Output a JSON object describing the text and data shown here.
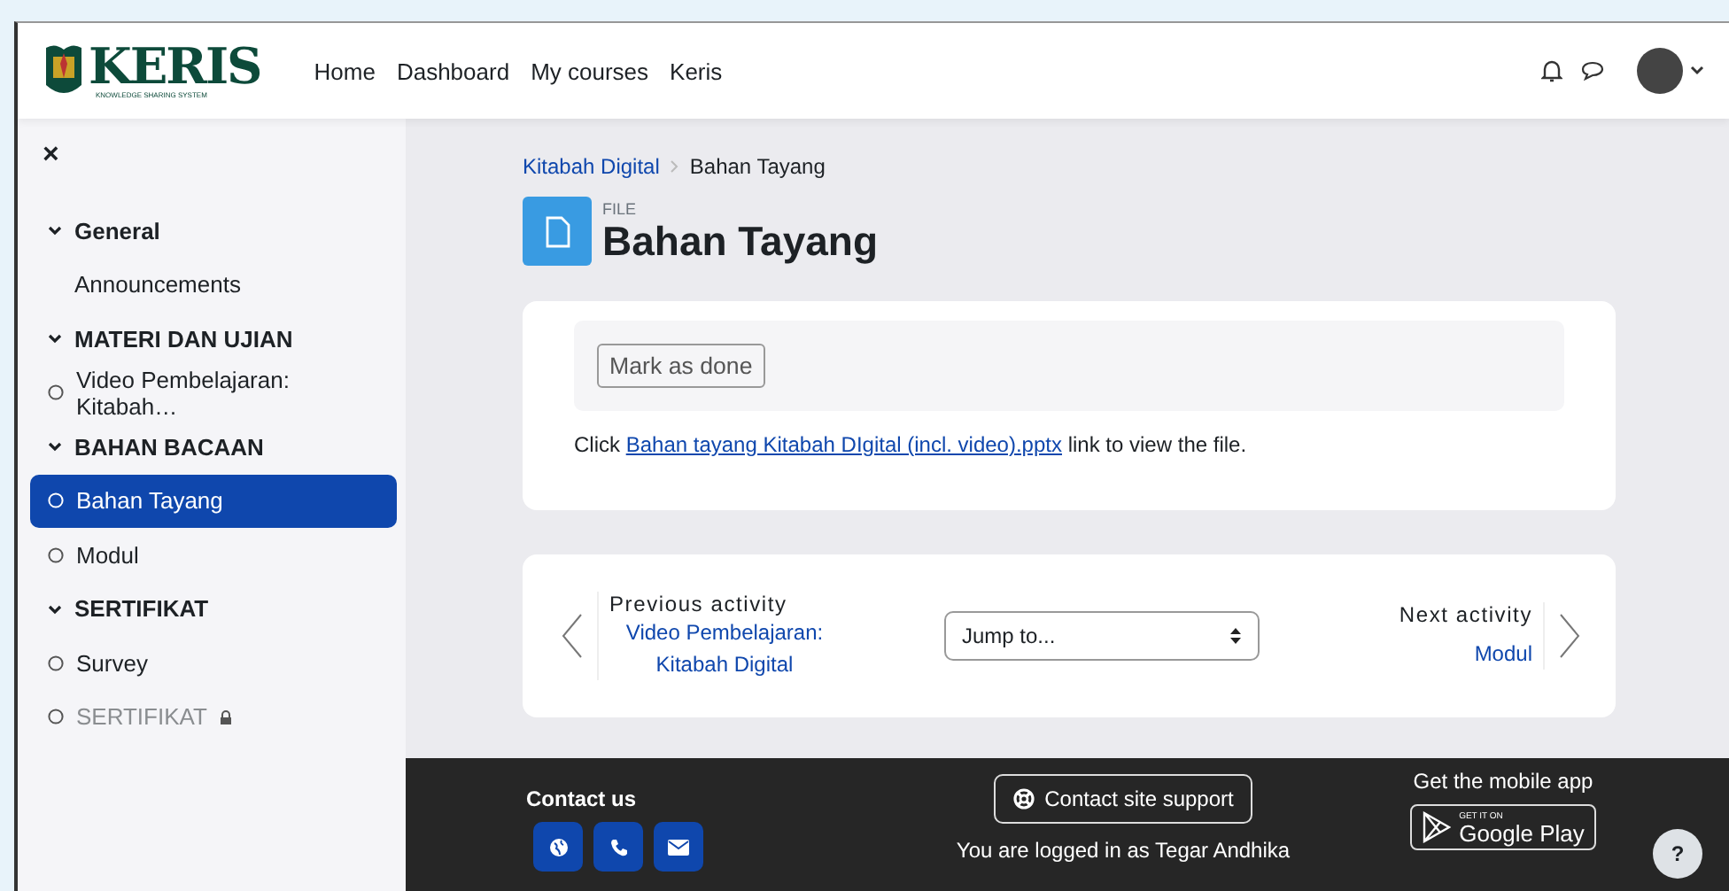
{
  "navbar": {
    "brand": "KERIS",
    "tagline": "KNOWLEDGE SHARING SYSTEM",
    "links": [
      "Home",
      "Dashboard",
      "My courses",
      "Keris"
    ]
  },
  "sidebar": {
    "close": "×",
    "items": [
      {
        "kind": "section",
        "label": "General",
        "expanded": true
      },
      {
        "kind": "plain",
        "label": "Announcements"
      },
      {
        "kind": "section",
        "label": "MATERI DAN UJIAN",
        "expanded": true
      },
      {
        "kind": "activity",
        "label": "Video Pembelajaran: Kitabah…",
        "selected": false,
        "locked": false
      },
      {
        "kind": "section",
        "label": "BAHAN BACAAN",
        "expanded": true
      },
      {
        "kind": "activity",
        "label": "Bahan Tayang",
        "selected": true,
        "locked": false
      },
      {
        "kind": "activity",
        "label": "Modul",
        "selected": false,
        "locked": false
      },
      {
        "kind": "section",
        "label": "SERTIFIKAT",
        "expanded": true
      },
      {
        "kind": "activity",
        "label": "Survey",
        "selected": false,
        "locked": false
      },
      {
        "kind": "activity",
        "label": "SERTIFIKAT",
        "selected": false,
        "locked": true
      }
    ]
  },
  "breadcrumb": [
    "Kitabah Digital",
    "Bahan Tayang"
  ],
  "header": {
    "type": "FILE",
    "title": "Bahan Tayang"
  },
  "content": {
    "button": "Mark as done",
    "prefix": "Click ",
    "link": "Bahan tayang Kitabah DIgital (incl. video).pptx",
    "suffix": " link to view the file."
  },
  "activity_nav": {
    "previous_label": "Previous activity",
    "previous": "Video Pembelajaran: Kitabah Digital",
    "jump_placeholder": "Jump to...",
    "next_label": "Next activity",
    "next": "Modul"
  },
  "footer": {
    "contact_title": "Contact us",
    "support_button": "Contact site support",
    "logged_in": "You are logged in as Tegar Andhika",
    "app_title": "Get the mobile app",
    "store_small": "GET IT ON",
    "store_name": "Google Play",
    "help": "?"
  }
}
